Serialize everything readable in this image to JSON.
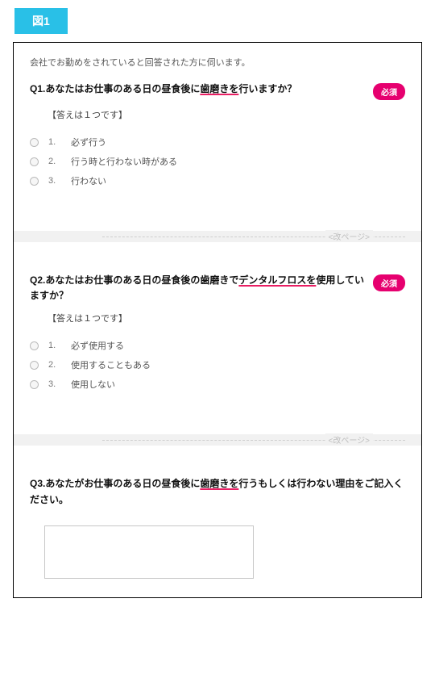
{
  "figure_label": "図1",
  "intro": "会社でお勤めをされていると回答された方に伺います。",
  "required_label": "必須",
  "answer_note": "【答えは１つです】",
  "page_break_label": "<改ページ>",
  "q1": {
    "prefix": "Q1.あなたはお仕事のある日の昼食後に",
    "keyword": "歯磨きを",
    "suffix": "行いますか？",
    "options": [
      {
        "num": "1.",
        "label": "必ず行う"
      },
      {
        "num": "2.",
        "label": "行う時と行わない時がある"
      },
      {
        "num": "3.",
        "label": "行わない"
      }
    ]
  },
  "q2": {
    "prefix": "Q2.あなたはお仕事のある日の昼食後の歯磨きで",
    "keyword": "デンタルフロスを",
    "suffix": "使用していますか？",
    "options": [
      {
        "num": "1.",
        "label": "必ず使用する"
      },
      {
        "num": "2.",
        "label": "使用することもある"
      },
      {
        "num": "3.",
        "label": "使用しない"
      }
    ]
  },
  "q3": {
    "prefix": "Q3.あなたがお仕事のある日の昼食後に",
    "keyword": "歯磨きを",
    "suffix": "行うもしくは行わない理由をご記入ください。"
  }
}
